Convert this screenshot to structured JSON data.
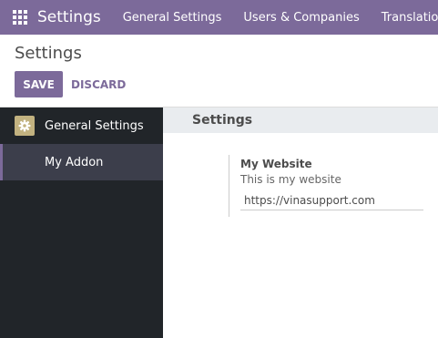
{
  "topbar": {
    "app_icon": "apps-grid-icon",
    "app_title": "Settings",
    "menu": [
      "General Settings",
      "Users & Companies",
      "Translations"
    ]
  },
  "control_panel": {
    "breadcrumb": "Settings",
    "save_label": "SAVE",
    "discard_label": "DISCARD"
  },
  "sidebar": {
    "items": [
      {
        "label": "General Settings",
        "icon": "gear-icon"
      },
      {
        "label": "My Addon"
      }
    ]
  },
  "main": {
    "section_title": "Settings",
    "setting": {
      "title": "My Website",
      "description": "This is my website",
      "value": "https://vinasupport.com"
    }
  },
  "colors": {
    "brand": "#7c6a9a",
    "sidebar_bg": "#212529",
    "sidebar_active": "#3c3e4b",
    "app_icon_bg": "#c2b280"
  }
}
